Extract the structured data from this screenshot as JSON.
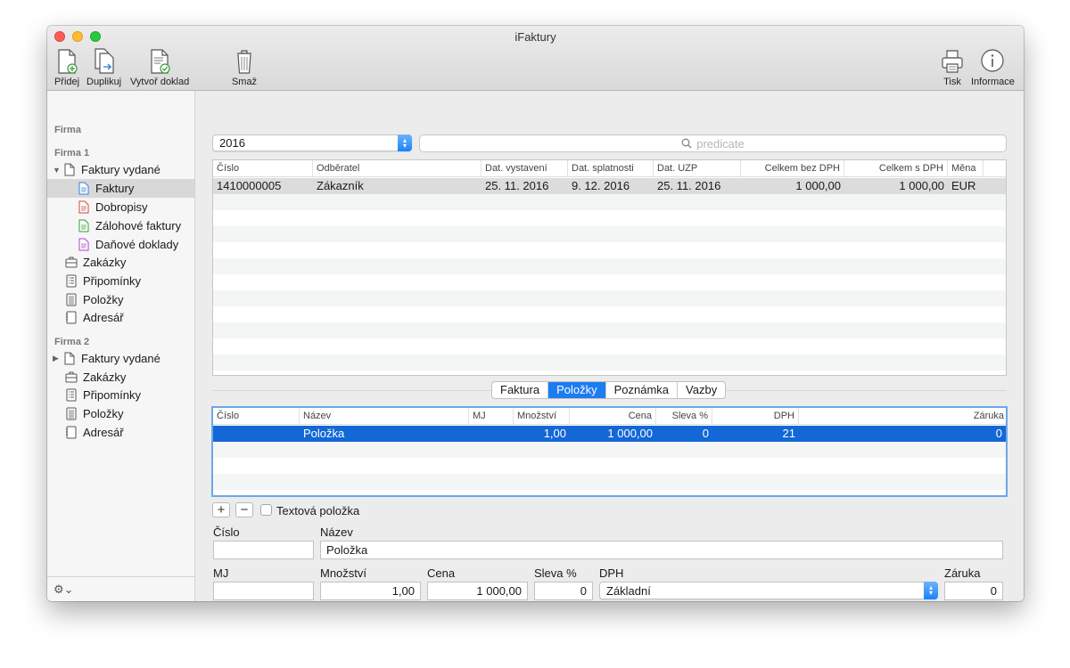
{
  "window": {
    "title": "iFaktury"
  },
  "toolbar": {
    "add": "Přidej",
    "duplicate": "Duplikuj",
    "create_doc": "Vytvoř doklad",
    "delete": "Smaž",
    "print": "Tisk",
    "info": "Informace"
  },
  "sidebar": {
    "header": "Firma",
    "group1": {
      "title": "Firma 1",
      "issued": "Faktury vydané",
      "sub": [
        "Faktury",
        "Dobropisy",
        "Zálohové faktury",
        "Daňové doklady"
      ],
      "items": [
        "Zakázky",
        "Připomínky",
        "Položky",
        "Adresář"
      ]
    },
    "group2": {
      "title": "Firma 2",
      "issued": "Faktury vydané",
      "items": [
        "Zakázky",
        "Připomínky",
        "Položky",
        "Adresář"
      ]
    }
  },
  "filter": {
    "year": "2016",
    "search_placeholder": "predicate"
  },
  "invoices": {
    "columns": [
      "Číslo",
      "Odběratel",
      "Dat. vystavení",
      "Dat. splatnosti",
      "Dat. UZP",
      "Celkem bez DPH",
      "Celkem s DPH",
      "Měna"
    ],
    "rows": [
      {
        "cislo": "1410000005",
        "odberatel": "Zákazník",
        "vystaveni": "25. 11. 2016",
        "splatnost": "9. 12. 2016",
        "uzp": "25. 11. 2016",
        "bez_dph": "1 000,00",
        "s_dph": "1 000,00",
        "mena": "EUR"
      }
    ]
  },
  "tabs": {
    "items": [
      "Faktura",
      "Položky",
      "Poznámka",
      "Vazby"
    ],
    "active": "Položky"
  },
  "items_table": {
    "columns": [
      "Číslo",
      "Název",
      "MJ",
      "Množství",
      "Cena",
      "Sleva %",
      "DPH",
      "Záruka"
    ],
    "rows": [
      {
        "cislo": "",
        "nazev": "Položka",
        "mj": "",
        "mnozstvi": "1,00",
        "cena": "1 000,00",
        "sleva": "0",
        "dph": "21",
        "zaruka": "0"
      }
    ]
  },
  "item_controls": {
    "add": "+",
    "remove": "−",
    "text_item": "Textová položka"
  },
  "form": {
    "cislo_label": "Číslo",
    "cislo_value": "",
    "nazev_label": "Název",
    "nazev_value": "Položka",
    "mj_label": "MJ",
    "mj_value": "",
    "mnozstvi_label": "Množství",
    "mnozstvi_value": "1,00",
    "cena_label": "Cena",
    "cena_value": "1 000,00",
    "sleva_label": "Sleva %",
    "sleva_value": "0",
    "dph_label": "DPH",
    "dph_value": "Základní",
    "zaruka_label": "Záruka",
    "zaruka_value": "0"
  },
  "colors": {
    "selection": "#1467d6",
    "segment_active": "#1d7cf2",
    "popup_arrow": "#1a82fb"
  }
}
